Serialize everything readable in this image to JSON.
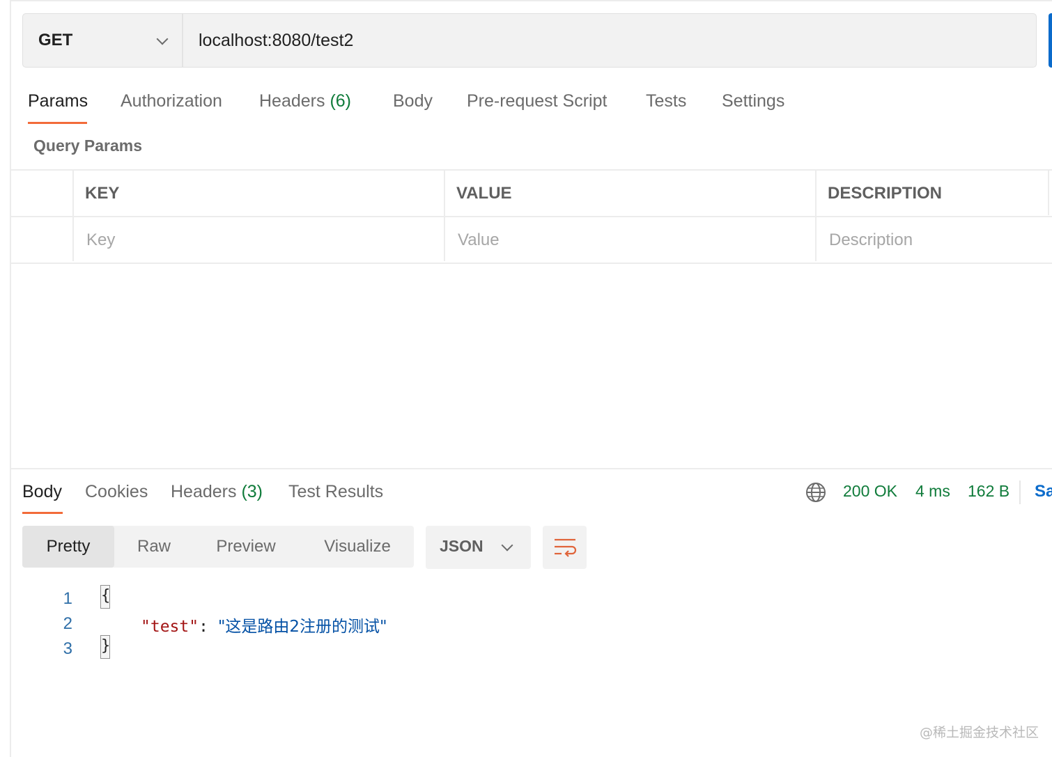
{
  "request": {
    "method": "GET",
    "url": "localhost:8080/test2"
  },
  "request_tabs": [
    {
      "label": "Params"
    },
    {
      "label": "Authorization"
    },
    {
      "label": "Headers",
      "count": "(6)"
    },
    {
      "label": "Body"
    },
    {
      "label": "Pre-request Script"
    },
    {
      "label": "Tests"
    },
    {
      "label": "Settings"
    }
  ],
  "query_params": {
    "title": "Query Params",
    "headers": [
      "KEY",
      "VALUE",
      "DESCRIPTION"
    ],
    "placeholders": [
      "Key",
      "Value",
      "Description"
    ]
  },
  "response_tabs": [
    {
      "label": "Body"
    },
    {
      "label": "Cookies"
    },
    {
      "label": "Headers",
      "count": "(3)"
    },
    {
      "label": "Test Results"
    }
  ],
  "response_meta": {
    "status": "200 OK",
    "time": "4 ms",
    "size": "162 B",
    "save_partial": "Sa"
  },
  "format_options": [
    "Pretty",
    "Raw",
    "Preview",
    "Visualize"
  ],
  "language": "JSON",
  "code": {
    "line_numbers": [
      "1",
      "2",
      "3"
    ],
    "open_brace": "{",
    "close_brace": "}",
    "key": "\"test\"",
    "colon": ":",
    "value": "\"这是路由2注册的测试\""
  },
  "watermark": "@稀土掘金技术社区",
  "colors": {
    "accent_underline": "#f26b3a",
    "status_green": "#0f7b3a",
    "send_blue": "#0b6bcb",
    "json_key": "#a31515",
    "json_string": "#0451a5"
  },
  "icons": [
    "chevron-down-icon",
    "globe-icon",
    "wrap-lines-icon"
  ]
}
